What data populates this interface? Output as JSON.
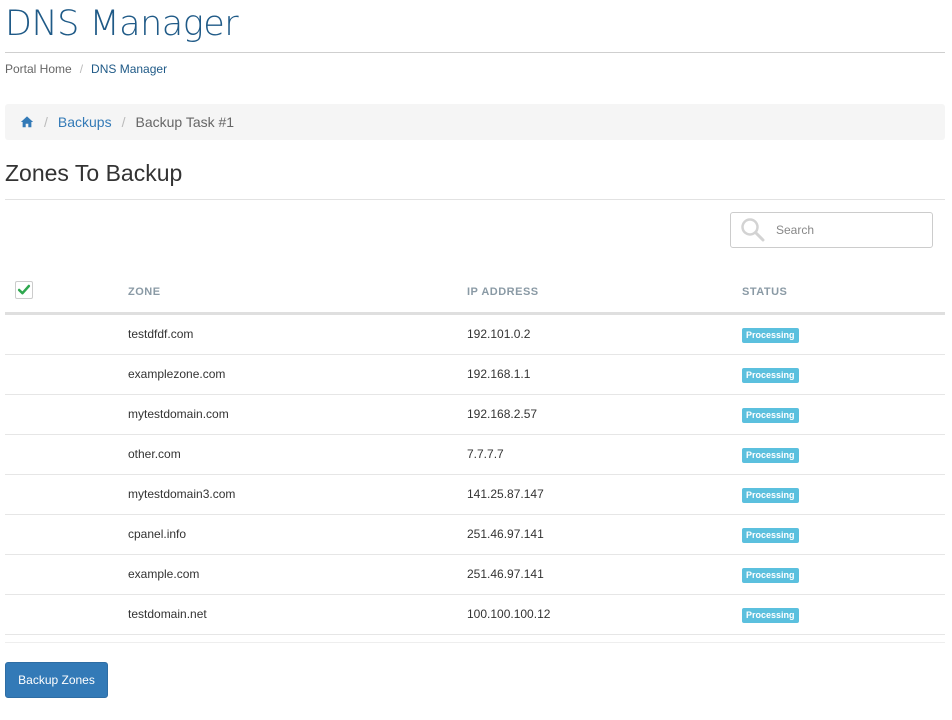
{
  "page": {
    "title": "DNS Manager"
  },
  "top_breadcrumb": {
    "home": "Portal Home",
    "separator": "/",
    "current": "DNS Manager"
  },
  "breadcrumb": {
    "separator": "/",
    "backups": "Backups",
    "current": "Backup Task #1"
  },
  "section": {
    "title": "Zones To Backup"
  },
  "search": {
    "placeholder": "Search",
    "value": ""
  },
  "table": {
    "columns": [
      "ZONE",
      "IP ADDRESS",
      "STATUS"
    ],
    "select_all_checked": true,
    "rows": [
      {
        "zone": "testdfdf.com",
        "ip": "192.101.0.2",
        "status": "Processing"
      },
      {
        "zone": "examplezone.com",
        "ip": "192.168.1.1",
        "status": "Processing"
      },
      {
        "zone": "mytestdomain.com",
        "ip": "192.168.2.57",
        "status": "Processing"
      },
      {
        "zone": "other.com",
        "ip": "7.7.7.7",
        "status": "Processing"
      },
      {
        "zone": "mytestdomain3.com",
        "ip": "141.25.87.147",
        "status": "Processing"
      },
      {
        "zone": "cpanel.info",
        "ip": "251.46.97.141",
        "status": "Processing"
      },
      {
        "zone": "example.com",
        "ip": "251.46.97.141",
        "status": "Processing"
      },
      {
        "zone": "testdomain.net",
        "ip": "100.100.100.12",
        "status": "Processing"
      }
    ]
  },
  "actions": {
    "backup_button": "Backup Zones"
  },
  "colors": {
    "title": "#1f5a87",
    "link": "#337ab7",
    "badge": "#5bc0de",
    "check": "#2fa84f",
    "button": "#337ab7"
  }
}
